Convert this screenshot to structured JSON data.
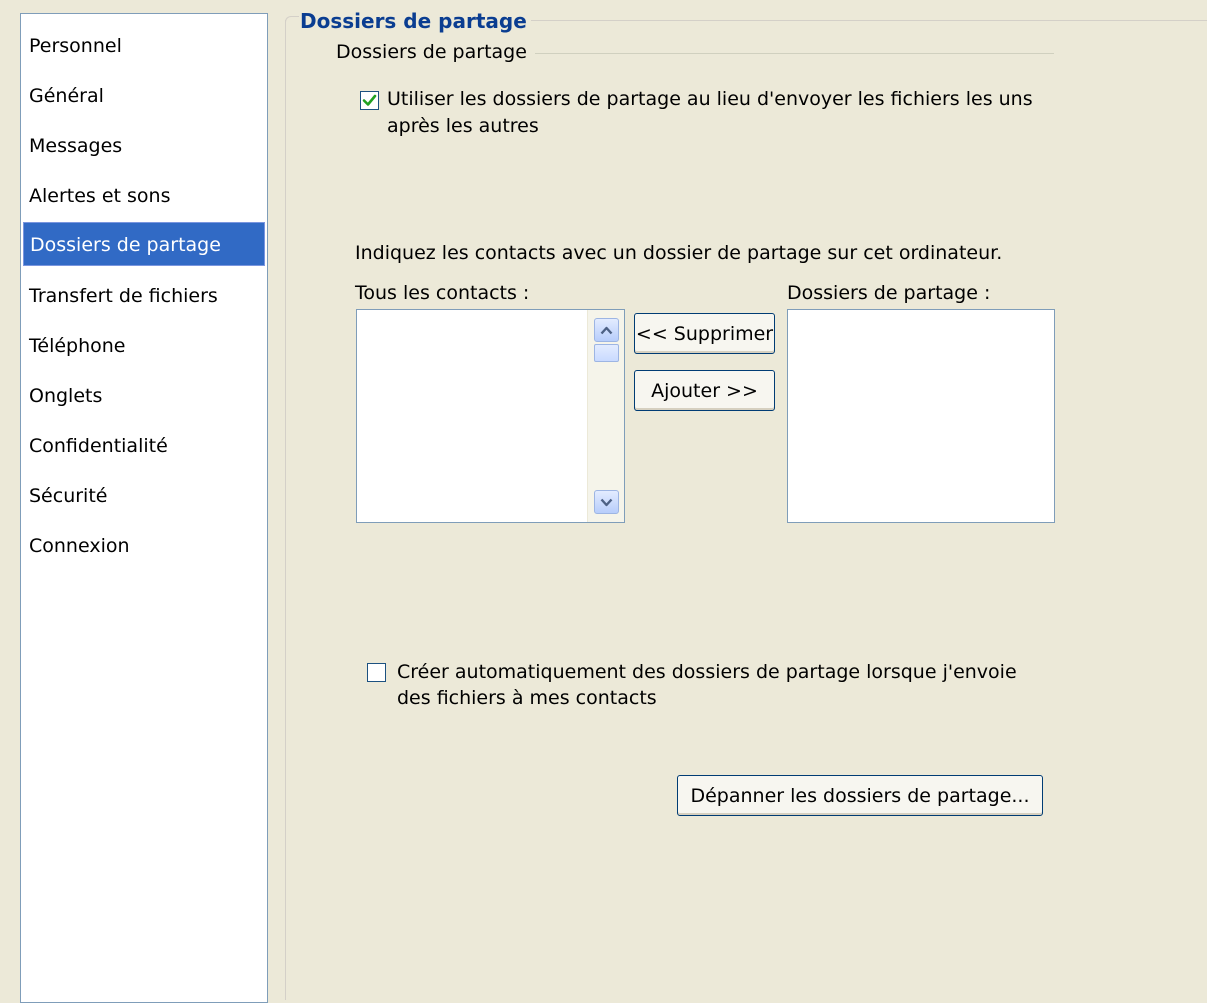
{
  "sidebar": {
    "items": [
      {
        "label": "Personnel"
      },
      {
        "label": "Général"
      },
      {
        "label": "Messages"
      },
      {
        "label": "Alertes et sons"
      },
      {
        "label": "Dossiers de partage"
      },
      {
        "label": "Transfert de fichiers"
      },
      {
        "label": "Téléphone"
      },
      {
        "label": "Onglets"
      },
      {
        "label": "Confidentialité"
      },
      {
        "label": "Sécurité"
      },
      {
        "label": "Connexion"
      }
    ],
    "selected_label": "Dossiers de partage"
  },
  "content": {
    "title": "Dossiers de partage",
    "group_label": "Dossiers de partage",
    "use_sharing_folders": {
      "checked": true,
      "line1": "Utiliser les dossiers de partage au lieu d'envoyer les fichiers les uns",
      "line2": "après les autres"
    },
    "instructions": "Indiquez les contacts avec un dossier de partage sur cet ordinateur.",
    "all_contacts_label": "Tous les contacts :",
    "sharing_folders_label": "Dossiers de partage :",
    "remove_button": "<< Supprimer",
    "add_button": "Ajouter >>",
    "auto_create": {
      "checked": false,
      "line1": "Créer automatiquement des dossiers de partage lorsque j'envoie",
      "line2": "des fichiers à mes contacts"
    },
    "troubleshoot_button": "Dépanner les dossiers de partage..."
  },
  "colors": {
    "window_bg": "#ece9d8",
    "selection": "#316ac5",
    "title": "#0a3d91",
    "check_mark": "#21a121"
  }
}
